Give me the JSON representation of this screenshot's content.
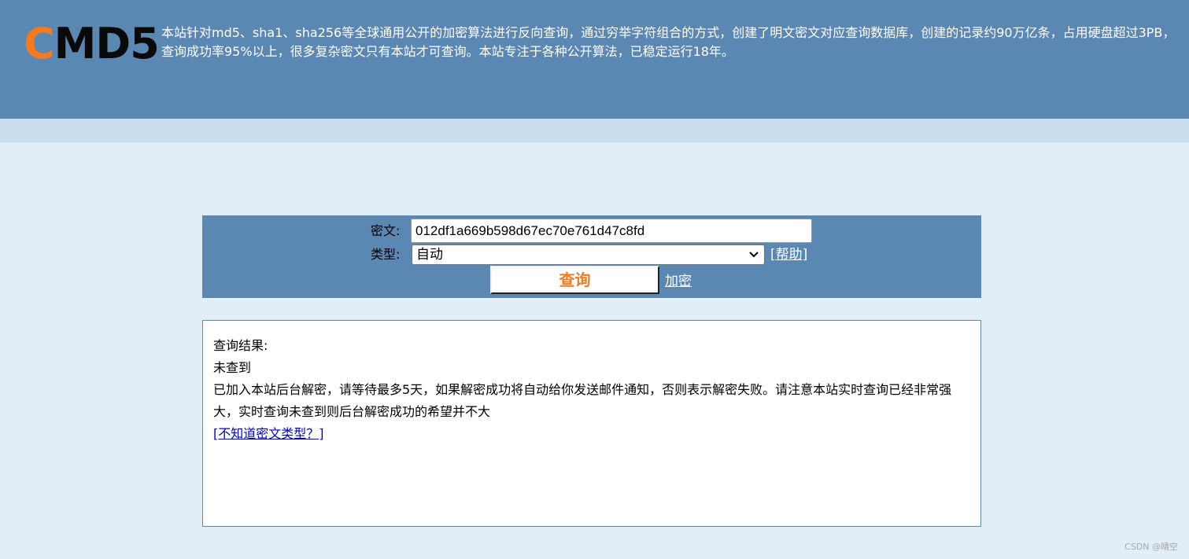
{
  "header": {
    "logo_first": "C",
    "logo_rest": "MD5",
    "description": "本站针对md5、sha1、sha256等全球通用公开的加密算法进行反向查询，通过穷举字符组合的方式，创建了明文密文对应查询数据库，创建的记录约90万亿条，占用硬盘超过3PB，查询成功率95%以上，很多复杂密文只有本站才可查询。本站专注于各种公开算法，已稳定运行18年。"
  },
  "search": {
    "cipher_label": "密文:",
    "cipher_value": "012df1a669b598d67ec70e761d47c8fd",
    "type_label": "类型:",
    "type_selected": "自动",
    "help_link": "[帮助]",
    "query_button": "查询",
    "encrypt_link": "加密"
  },
  "result": {
    "heading": "查询结果:",
    "status": "未查到",
    "detail": "已加入本站后台解密，请等待最多5天，如果解密成功将自动给你发送邮件通知，否则表示解密失败。请注意本站实时查询已经非常强大，实时查询未查到则后台解密成功的希望并不大",
    "link": "[不知道密文类型？]"
  },
  "footer": {
    "watermark": "CSDN @晴空"
  },
  "colors": {
    "header_bg": "#5b87b3",
    "subbar_bg": "#c9dfee",
    "page_bg": "#e1eef7",
    "logo_accent": "#f47b20",
    "query_text": "#f47b20"
  },
  "icons": {
    "select_arrow": "chevron-down-icon"
  }
}
